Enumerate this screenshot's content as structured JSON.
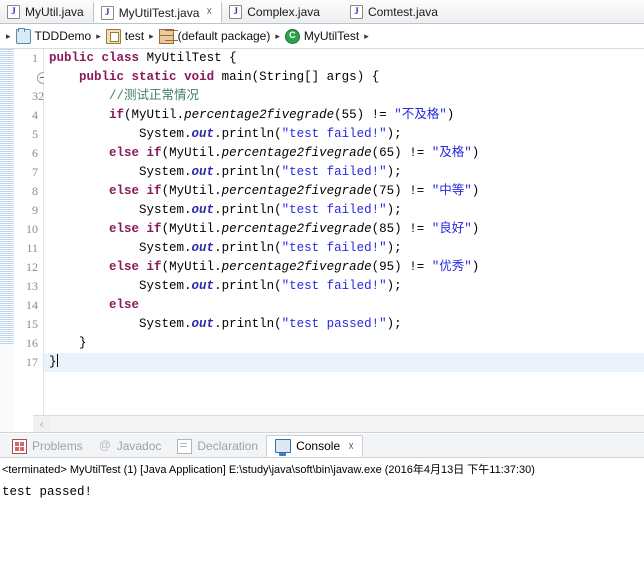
{
  "editor_tabs": [
    {
      "label": "MyUtil.java",
      "icon": "java-file-icon",
      "active": false,
      "closable": false
    },
    {
      "label": "MyUtilTest.java",
      "icon": "java-file-icon",
      "active": true,
      "closable": true,
      "close_glyph": "☓"
    },
    {
      "label": "Complex.java",
      "icon": "java-file-icon",
      "active": false,
      "closable": false
    },
    {
      "label": "Comtest.java",
      "icon": "java-file-icon",
      "active": false,
      "closable": false
    }
  ],
  "breadcrumb": {
    "separator": "▸",
    "items": [
      {
        "label": "TDDDemo",
        "icon": "project-folder-icon"
      },
      {
        "label": "test",
        "icon": "source-folder-icon"
      },
      {
        "label": "(default package)",
        "icon": "package-icon"
      },
      {
        "label": "MyUtilTest",
        "icon": "class-icon"
      }
    ]
  },
  "code": {
    "line_numbers": [
      "1",
      "2",
      "3",
      "4",
      "5",
      "6",
      "7",
      "8",
      "9",
      "10",
      "11",
      "12",
      "13",
      "14",
      "15",
      "16",
      "17"
    ],
    "fold_marker_line": "2",
    "current_line": "17",
    "lines": [
      "public class MyUtilTest {",
      "    public static void main(String[] args) {",
      "        //测试正常情况",
      "        if(MyUtil.percentage2fivegrade(55) != \"不及格\")",
      "            System.out.println(\"test failed!\");",
      "        else if(MyUtil.percentage2fivegrade(65) != \"及格\")",
      "            System.out.println(\"test failed!\");",
      "        else if(MyUtil.percentage2fivegrade(75) != \"中等\")",
      "            System.out.println(\"test failed!\");",
      "        else if(MyUtil.percentage2fivegrade(85) != \"良好\")",
      "            System.out.println(\"test failed!\");",
      "        else if(MyUtil.percentage2fivegrade(95) != \"优秀\")",
      "            System.out.println(\"test failed!\");",
      "        else",
      "            System.out.println(\"test passed!\");",
      "    }",
      "}"
    ],
    "tokens": {
      "kw_public": "public",
      "kw_class": "class",
      "kw_static": "static",
      "kw_void": "void",
      "kw_if": "if",
      "kw_else": "else",
      "type_String": "String",
      "name_MyUtilTest": "MyUtilTest",
      "name_main": "main",
      "name_args": "args",
      "name_MyUtil": "MyUtil",
      "name_method": "percentage2fivegrade",
      "name_System": "System",
      "field_out": "out",
      "name_println": "println",
      "comment": "//测试正常情况",
      "str_fail": "\"test failed!\"",
      "str_pass": "\"test passed!\"",
      "str_bujige": "\"不及格\"",
      "str_jige": "\"及格\"",
      "str_zhongdeng": "\"中等\"",
      "str_lianghao": "\"良好\"",
      "str_youxiu": "\"优秀\"",
      "arg55": "55",
      "arg65": "65",
      "arg75": "75",
      "arg85": "85",
      "arg95": "95",
      "neq": "!="
    }
  },
  "editor_scrollbar": {
    "left_arrow": "‹"
  },
  "bottom_tabs": [
    {
      "label": "Problems",
      "icon": "problems-icon",
      "active": false
    },
    {
      "label": "Javadoc",
      "icon": "javadoc-icon",
      "active": false
    },
    {
      "label": "Declaration",
      "icon": "declaration-icon",
      "active": false
    },
    {
      "label": "Console",
      "icon": "console-icon",
      "active": true,
      "close_glyph": "☓"
    }
  ],
  "console": {
    "status_line": "<terminated> MyUtilTest (1) [Java Application] E:\\study\\java\\soft\\bin\\javaw.exe (2016年4月13日 下午11:37:30)",
    "output": "test passed!"
  },
  "colors": {
    "keyword": "#8b1a5a",
    "string": "#2a2ae0",
    "comment": "#3f7f5f",
    "field": "#2a2aa8",
    "current_line_bg": "#eaf2fb",
    "ruler_stripe": "#bcd6ee",
    "tab_border": "#b6c4d4"
  }
}
